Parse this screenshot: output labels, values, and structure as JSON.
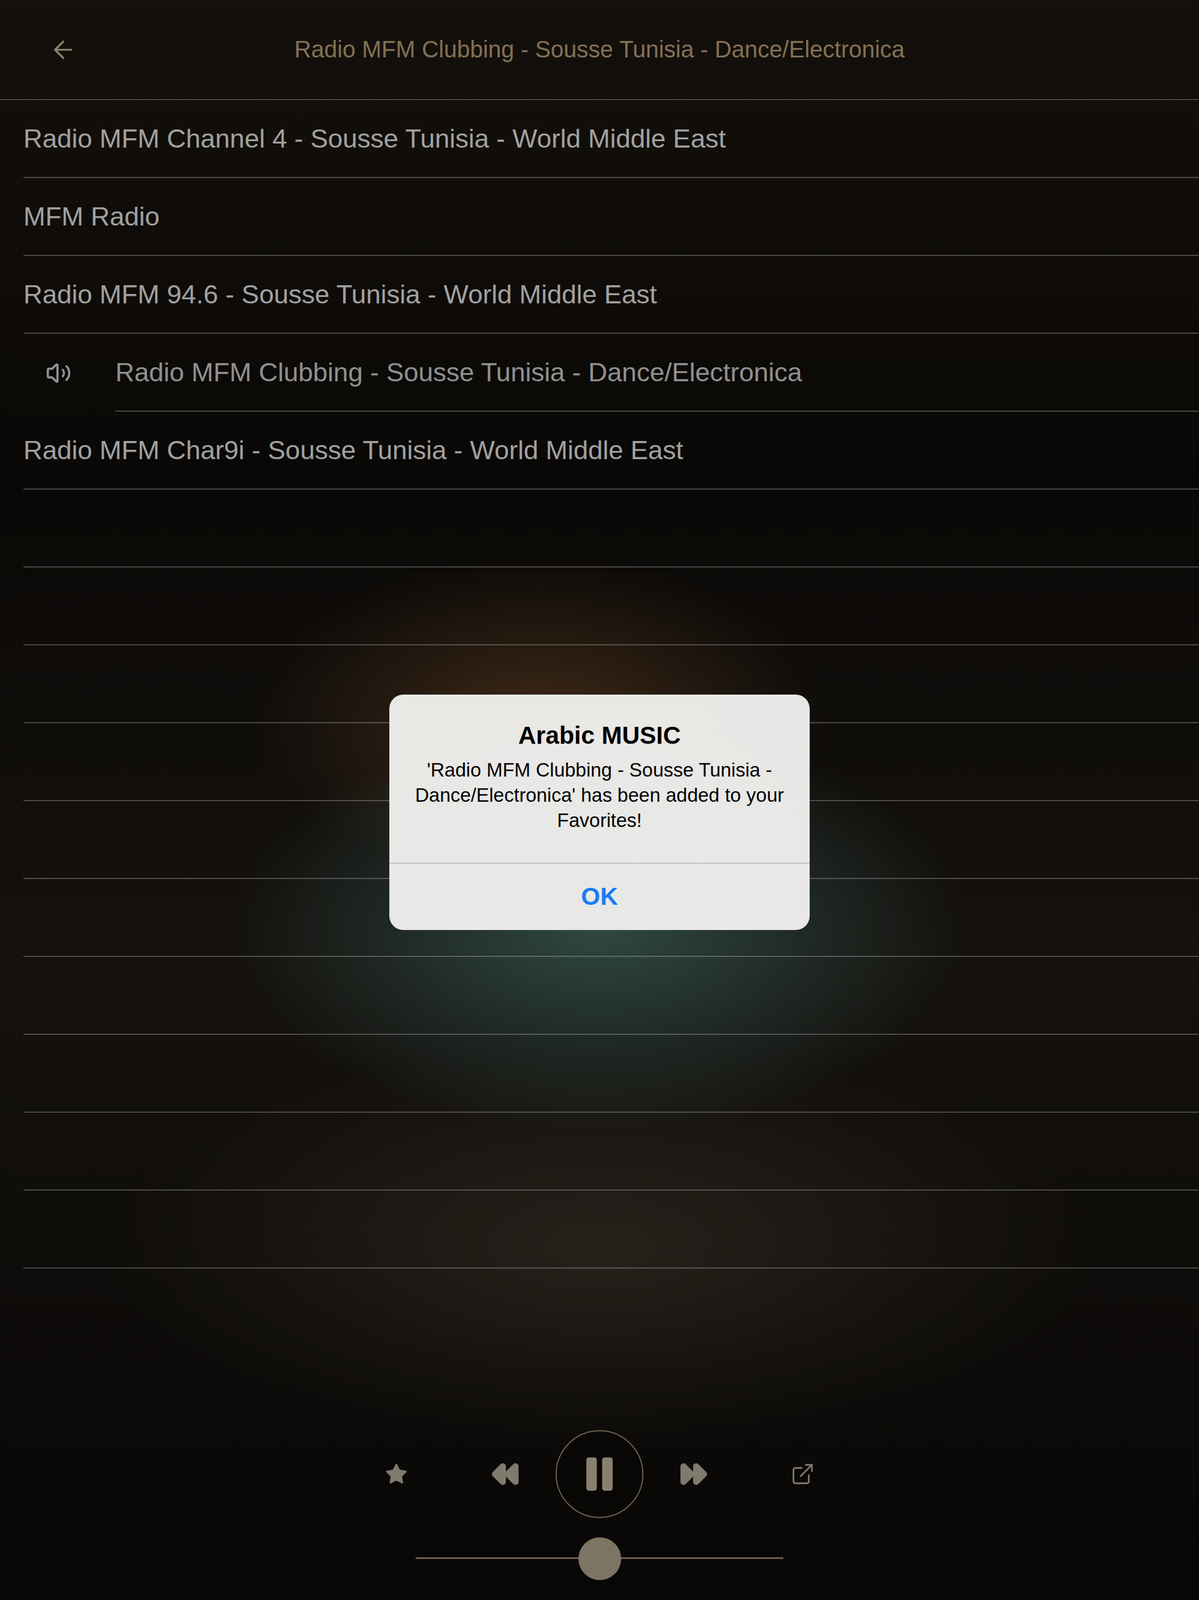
{
  "header": {
    "title": "Radio MFM Clubbing - Sousse Tunisia - Dance/Electronica"
  },
  "stations": [
    {
      "name": "Radio MFM Channel 4 - Sousse Tunisia - World Middle East",
      "playing": false
    },
    {
      "name": "MFM Radio",
      "playing": false
    },
    {
      "name": "Radio MFM 94.6 - Sousse Tunisia - World Middle East",
      "playing": false
    },
    {
      "name": "Radio MFM Clubbing - Sousse Tunisia - Dance/Electronica",
      "playing": true
    },
    {
      "name": "Radio MFM Char9i - Sousse Tunisia - World Middle East",
      "playing": false
    }
  ],
  "player": {
    "playing": true,
    "favorite": false,
    "volume": {
      "level": 0.5
    }
  },
  "alert": {
    "title": "Arabic MUSIC",
    "message": "'Radio MFM Clubbing - Sousse Tunisia - Dance/Electronica' has been added to your Favorites!",
    "buttons": [
      "OK"
    ]
  }
}
